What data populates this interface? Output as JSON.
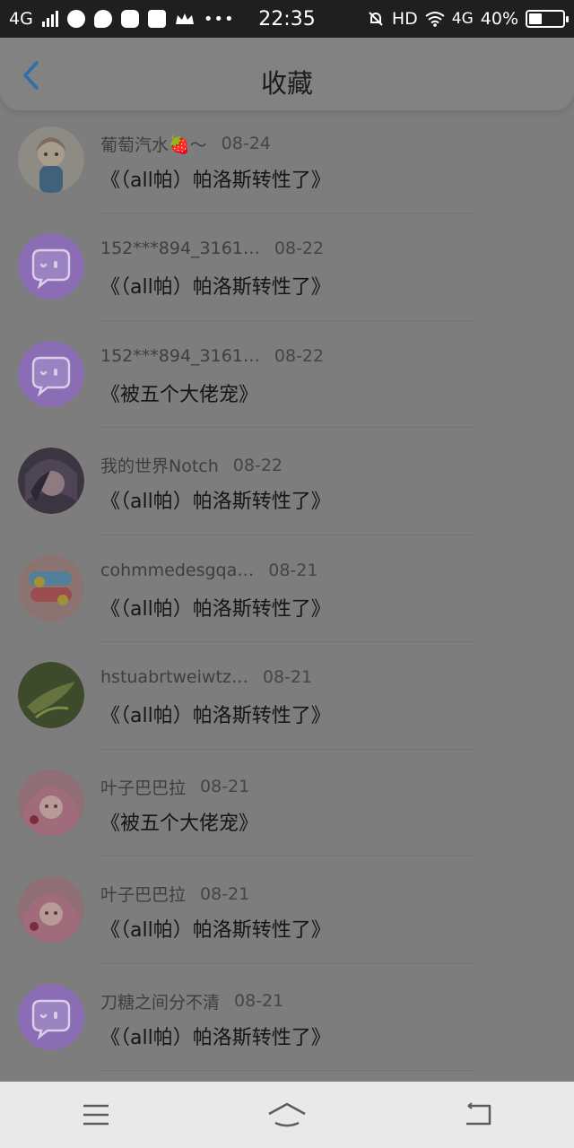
{
  "status_bar": {
    "network": "4G",
    "time": "22:35",
    "hd": "HD",
    "net2": "4G",
    "battery": "40%",
    "battery_level": 0.4
  },
  "header": {
    "title": "收藏"
  },
  "items": [
    {
      "user": "",
      "date": "",
      "book": "《（all帕）帕洛斯转性了》",
      "avatar": "avatar-dark-green"
    },
    {
      "user": "葡萄汽水🍓～",
      "date": "08-24",
      "book": "《（all帕）帕洛斯转性了》",
      "avatar": "avatar-anime-girl"
    },
    {
      "user": "152***894_3161…",
      "date": "08-22",
      "book": "《（all帕）帕洛斯转性了》",
      "avatar": "avatar-default-chat"
    },
    {
      "user": "152***894_3161…",
      "date": "08-22",
      "book": "《被五个大佬宠》",
      "avatar": "avatar-default-chat"
    },
    {
      "user": "我的世界Notch",
      "date": "08-22",
      "book": "《（all帕）帕洛斯转性了》",
      "avatar": "avatar-anime-dark"
    },
    {
      "user": "cohmmedesgqa…",
      "date": "08-21",
      "book": "《（all帕）帕洛斯转性了》",
      "avatar": "avatar-colorful"
    },
    {
      "user": "hstuabrtweiwtz…",
      "date": "08-21",
      "book": "《（all帕）帕洛斯转性了》",
      "avatar": "avatar-leaf"
    },
    {
      "user": "叶子巴巴拉",
      "date": "08-21",
      "book": "《被五个大佬宠》",
      "avatar": "avatar-pink-girl"
    },
    {
      "user": "叶子巴巴拉",
      "date": "08-21",
      "book": "《（all帕）帕洛斯转性了》",
      "avatar": "avatar-pink-girl"
    },
    {
      "user": "刀糖之间分不清",
      "date": "08-21",
      "book": "《（all帕）帕洛斯转性了》",
      "avatar": "avatar-default-chat"
    }
  ],
  "colors": {
    "accent": "#2a6fb0",
    "default_avatar": "#8a65b5"
  },
  "nav": {
    "menu_icon": "menu-icon",
    "home_icon": "home-icon",
    "back_icon": "back-icon"
  }
}
